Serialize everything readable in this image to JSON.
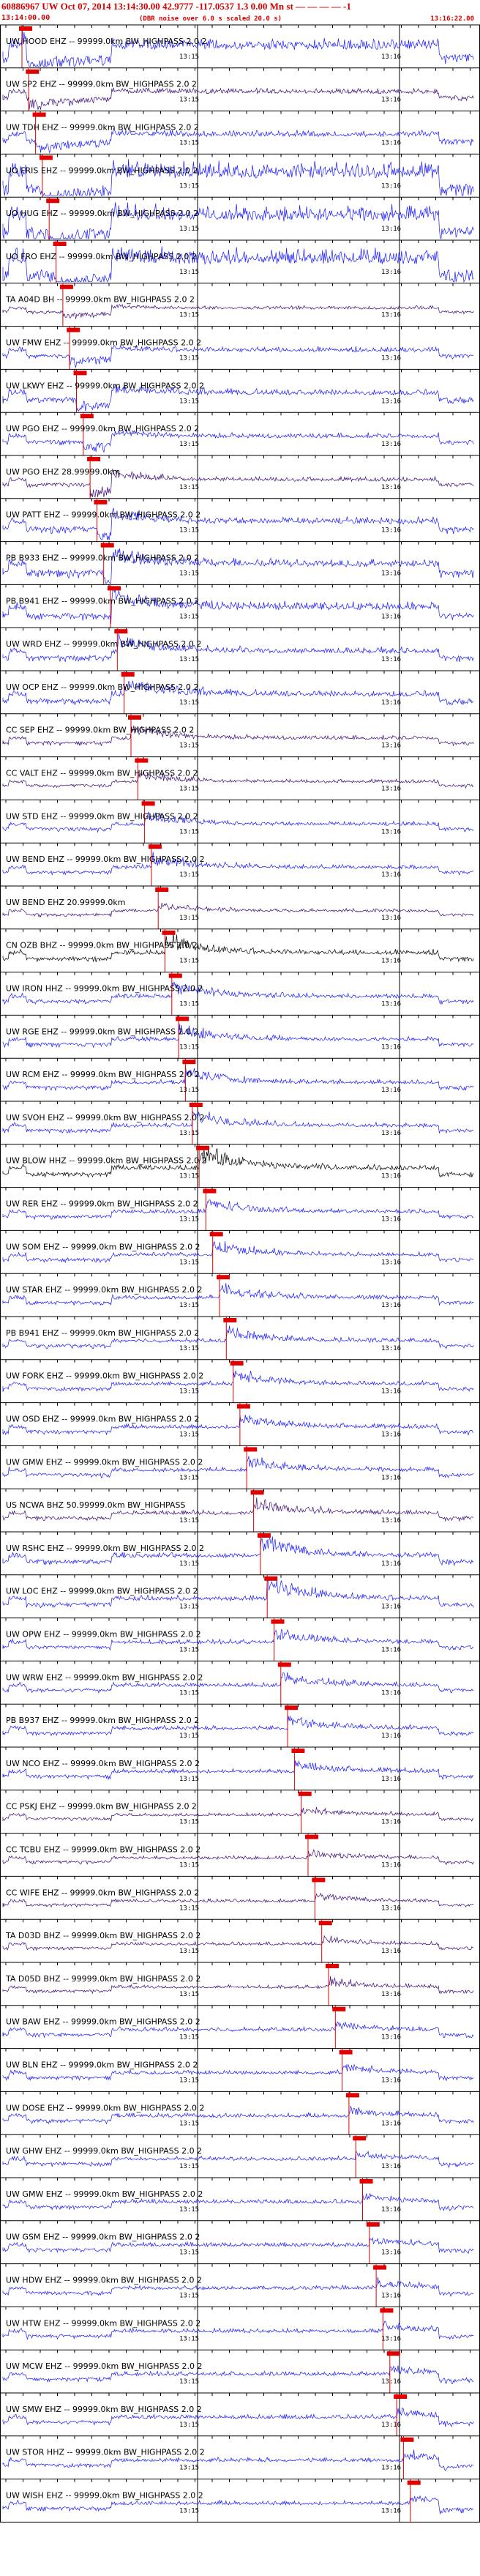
{
  "header": {
    "title": "60886967  UW  Oct 07, 2014 13:14:30.00    42.9777  -117.0537   1.3  0.00  Mn  st  — — — — -1",
    "time_left": "13:14:00.00",
    "note": "(DBR noise over 6.0 s scaled 20.0 s)",
    "time_right": "13:16:22.00"
  },
  "tick_labels": {
    "first": "13:15",
    "second": "13:16"
  },
  "colors": {
    "blue": "#1a1aff",
    "purple": "#3d0b78",
    "black": "#000000",
    "pick": "#e00000",
    "grid": "#000000"
  },
  "channels": [
    {
      "label": "UW HOOD EHZ -- 99999.0km BW_HIGHPASS  2.0  2",
      "color": "blue",
      "amp": 0.65,
      "burst": 0.55
    },
    {
      "label": "UW SP2 EHZ -- 99999.0km BW_HIGHPASS  2.0  2",
      "color": "purple",
      "amp": 0.3,
      "burst": 0.5
    },
    {
      "label": "UW TDH EHZ -- 99999.0km BW_HIGHPASS  2.0  2",
      "color": "blue",
      "amp": 0.35,
      "burst": 0.4
    },
    {
      "label": "UO FRIS EHZ -- 99999.0km BW_HIGHPASS  2.0  2",
      "color": "blue",
      "amp": 0.9,
      "burst": 0.6
    },
    {
      "label": "UO HUG EHZ -- 99999.0km BW_HIGHPASS  2.0  2",
      "color": "blue",
      "amp": 0.9,
      "burst": 0.6
    },
    {
      "label": "UO FRO EHZ -- 99999.0km BW_HIGHPASS  2.0  2",
      "color": "blue",
      "amp": 0.9,
      "burst": 0.6
    },
    {
      "label": "TA A04D BH -- 99999.0km BW_HIGHPASS  2.0  2",
      "color": "purple",
      "amp": 0.2,
      "burst": 0.3
    },
    {
      "label": "UW FMW EHZ -- 99999.0km BW_HIGHPASS  2.0  2",
      "color": "blue",
      "amp": 0.3,
      "burst": 0.4
    },
    {
      "label": "UW LKWY EHZ -- 99999.0km BW_HIGHPASS  2.0  2",
      "color": "blue",
      "amp": 0.35,
      "burst": 0.5
    },
    {
      "label": "UW PGO EHZ -- 99999.0km BW_HIGHPASS  2.0  2",
      "color": "blue",
      "amp": 0.3,
      "burst": 0.4
    },
    {
      "label": "UW PGO EHZ 28.99999.0km",
      "color": "purple",
      "amp": 0.25,
      "burst": 0.6
    },
    {
      "label": "UW PATT EHZ -- 99999.0km BW_HIGHPASS  2.0  2",
      "color": "blue",
      "amp": 0.4,
      "burst": 0.6
    },
    {
      "label": "PB B933 EHZ -- 99999.0km BW_HIGHPASS  2.0  2",
      "color": "blue",
      "amp": 0.45,
      "burst": 0.7
    },
    {
      "label": "PB B941 EHZ -- 99999.0km BW_HIGHPASS  2.0  2",
      "color": "blue",
      "amp": 0.45,
      "burst": 0.7
    },
    {
      "label": "UW WRD EHZ -- 99999.0km BW_HIGHPASS  2.0  2",
      "color": "blue",
      "amp": 0.35,
      "burst": 0.6
    },
    {
      "label": "UW OCP EHZ -- 99999.0km BW_HIGHPASS  2.0  2",
      "color": "blue",
      "amp": 0.35,
      "burst": 0.6
    },
    {
      "label": "CC SEP EHZ -- 99999.0km BW_HIGHPASS  2.0  2",
      "color": "purple",
      "amp": 0.25,
      "burst": 0.5
    },
    {
      "label": "CC VALT EHZ -- 99999.0km BW_HIGHPASS  2.0  2",
      "color": "purple",
      "amp": 0.2,
      "burst": 0.4
    },
    {
      "label": "UW STD EHZ -- 99999.0km BW_HIGHPASS  2.0  2",
      "color": "blue",
      "amp": 0.25,
      "burst": 0.5
    },
    {
      "label": "UW BEND EHZ -- 99999.0km BW_HIGHPASS  2.0  2",
      "color": "blue",
      "amp": 0.25,
      "burst": 0.5
    },
    {
      "label": "UW BEND EHZ 20.99999.0km",
      "color": "purple",
      "amp": 0.2,
      "burst": 0.3
    },
    {
      "label": "CN OZB BHZ -- 99999.0km BW_HIGHPASS  2.0  2",
      "color": "black",
      "amp": 0.3,
      "burst": 0.7
    },
    {
      "label": "UW IRON HHZ -- 99999.0km BW_HIGHPASS  2.0  2",
      "color": "blue",
      "amp": 0.25,
      "burst": 0.6
    },
    {
      "label": "UW RGE EHZ -- 99999.0km BW_HIGHPASS  2.0  2",
      "color": "blue",
      "amp": 0.25,
      "burst": 0.6
    },
    {
      "label": "UW RCM EHZ -- 99999.0km BW_HIGHPASS  2.0  2",
      "color": "blue",
      "amp": 0.25,
      "burst": 0.6
    },
    {
      "label": "UW SVOH EHZ -- 99999.0km BW_HIGHPASS  2.0  2",
      "color": "blue",
      "amp": 0.25,
      "burst": 0.6
    },
    {
      "label": "UW BLOW HHZ -- 99999.0km BW_HIGHPASS  2.0  2",
      "color": "black",
      "amp": 0.3,
      "burst": 0.9
    },
    {
      "label": "UW RER EHZ -- 99999.0km BW_HIGHPASS  2.0  2",
      "color": "blue",
      "amp": 0.25,
      "burst": 0.5
    },
    {
      "label": "UW SOM EHZ -- 99999.0km BW_HIGHPASS  2.0  2",
      "color": "blue",
      "amp": 0.25,
      "burst": 0.5
    },
    {
      "label": "UW STAR EHZ -- 99999.0km BW_HIGHPASS  2.0  2",
      "color": "blue",
      "amp": 0.25,
      "burst": 0.5
    },
    {
      "label": "PB B941 EHZ -- 99999.0km BW_HIGHPASS  2.0  2",
      "color": "blue",
      "amp": 0.25,
      "burst": 0.5
    },
    {
      "label": "UW FORK EHZ -- 99999.0km BW_HIGHPASS  2.0  2",
      "color": "blue",
      "amp": 0.25,
      "burst": 0.5
    },
    {
      "label": "UW OSD EHZ -- 99999.0km BW_HIGHPASS  2.0  2",
      "color": "blue",
      "amp": 0.25,
      "burst": 0.5
    },
    {
      "label": "UW GMW EHZ -- 99999.0km BW_HIGHPASS  2.0  2",
      "color": "blue",
      "amp": 0.25,
      "burst": 0.5
    },
    {
      "label": "US NCWA BHZ 50.99999.0km BW_HIGHPASS",
      "color": "purple",
      "amp": 0.25,
      "burst": 0.6
    },
    {
      "label": "UW RSHC EHZ -- 99999.0km BW_HIGHPASS  2.0  2",
      "color": "blue",
      "amp": 0.3,
      "burst": 0.8
    },
    {
      "label": "UW LOC EHZ -- 99999.0km BW_HIGHPASS  2.0  2",
      "color": "blue",
      "amp": 0.3,
      "burst": 0.9
    },
    {
      "label": "UW OPW EHZ -- 99999.0km BW_HIGHPASS  2.0  2",
      "color": "blue",
      "amp": 0.25,
      "burst": 0.5
    },
    {
      "label": "UW WRW EHZ -- 99999.0km BW_HIGHPASS  2.0  2",
      "color": "blue",
      "amp": 0.25,
      "burst": 0.5
    },
    {
      "label": "PB B937 EHZ -- 99999.0km BW_HIGHPASS  2.0  2",
      "color": "blue",
      "amp": 0.25,
      "burst": 0.5
    },
    {
      "label": "UW NCO EHZ -- 99999.0km BW_HIGHPASS  2.0  2",
      "color": "blue",
      "amp": 0.25,
      "burst": 0.4
    },
    {
      "label": "CC PSKJ EHZ -- 99999.0km BW_HIGHPASS  2.0  2",
      "color": "purple",
      "amp": 0.2,
      "burst": 0.3
    },
    {
      "label": "CC TCBU EHZ -- 99999.0km BW_HIGHPASS  2.0  2",
      "color": "purple",
      "amp": 0.2,
      "burst": 0.3
    },
    {
      "label": "CC WIFE EHZ -- 99999.0km BW_HIGHPASS  2.0  2",
      "color": "purple",
      "amp": 0.2,
      "burst": 0.3
    },
    {
      "label": "TA D03D BHZ -- 99999.0km BW_HIGHPASS  2.0  2",
      "color": "purple",
      "amp": 0.2,
      "burst": 0.3
    },
    {
      "label": "TA D05D BHZ -- 99999.0km BW_HIGHPASS  2.0  2",
      "color": "purple",
      "amp": 0.2,
      "burst": 0.3
    },
    {
      "label": "UW BAW EHZ -- 99999.0km BW_HIGHPASS  2.0  2",
      "color": "blue",
      "amp": 0.25,
      "burst": 0.3
    },
    {
      "label": "UW BLN EHZ -- 99999.0km BW_HIGHPASS  2.0  2",
      "color": "blue",
      "amp": 0.25,
      "burst": 0.3
    },
    {
      "label": "UW DOSE EHZ -- 99999.0km BW_HIGHPASS  2.0  2",
      "color": "blue",
      "amp": 0.25,
      "burst": 0.3
    },
    {
      "label": "UW GHW EHZ -- 99999.0km BW_HIGHPASS  2.0  2",
      "color": "blue",
      "amp": 0.25,
      "burst": 0.3
    },
    {
      "label": "UW GMW EHZ -- 99999.0km BW_HIGHPASS  2.0  2",
      "color": "blue",
      "amp": 0.25,
      "burst": 0.3
    },
    {
      "label": "UW GSM EHZ -- 99999.0km BW_HIGHPASS  2.0  2",
      "color": "blue",
      "amp": 0.25,
      "burst": 0.3
    },
    {
      "label": "UW HDW EHZ -- 99999.0km BW_HIGHPASS  2.0  2",
      "color": "blue",
      "amp": 0.25,
      "burst": 0.3
    },
    {
      "label": "UW HTW EHZ -- 99999.0km BW_HIGHPASS  2.0  2",
      "color": "blue",
      "amp": 0.25,
      "burst": 0.3
    },
    {
      "label": "UW MCW EHZ -- 99999.0km BW_HIGHPASS  2.0  2",
      "color": "blue",
      "amp": 0.25,
      "burst": 0.3
    },
    {
      "label": "UW SMW EHZ -- 99999.0km BW_HIGHPASS  2.0  2",
      "color": "blue",
      "amp": 0.25,
      "burst": 0.3
    },
    {
      "label": "UW STOR HHZ -- 99999.0km BW_HIGHPASS  2.0  2",
      "color": "blue",
      "amp": 0.25,
      "burst": 0.3
    },
    {
      "label": "UW WISH EHZ -- 99999.0km BW_HIGHPASS  2.0  2",
      "color": "blue",
      "amp": 0.25,
      "burst": 0.3
    }
  ]
}
